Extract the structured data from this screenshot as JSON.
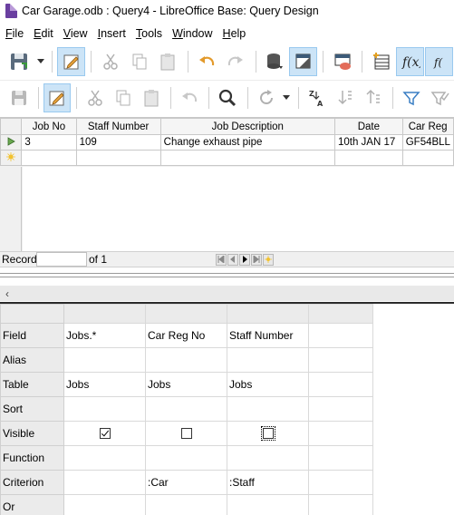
{
  "window": {
    "title": "Car Garage.odb : Query4 - LibreOffice Base: Query Design"
  },
  "menubar": [
    {
      "label": "File",
      "key": "F",
      "rest": "ile"
    },
    {
      "label": "Edit",
      "key": "E",
      "rest": "dit"
    },
    {
      "label": "View",
      "key": "V",
      "rest": "iew"
    },
    {
      "label": "Insert",
      "key": "I",
      "rest": "nsert"
    },
    {
      "label": "Tools",
      "key": "T",
      "rest": "ools"
    },
    {
      "label": "Window",
      "key": "W",
      "rest": "indow"
    },
    {
      "label": "Help",
      "key": "H",
      "rest": "elp"
    }
  ],
  "results": {
    "columns": [
      "Job No",
      "Staff Number",
      "Job Description",
      "Date",
      "Car Reg"
    ],
    "rows": [
      [
        "3",
        "109",
        "Change exhaust pipe",
        "10th JAN 17",
        "GF54BLL"
      ]
    ]
  },
  "recordbar": {
    "label": "Record",
    "value": "",
    "of_text": "of 1"
  },
  "design": {
    "row_labels": [
      "Field",
      "Alias",
      "Table",
      "Sort",
      "Visible",
      "Function",
      "Criterion",
      "Or"
    ],
    "columns": [
      {
        "field": "Jobs.*",
        "alias": "",
        "table": "Jobs",
        "sort": "",
        "visible": true,
        "function": "",
        "criterion": "",
        "or": ""
      },
      {
        "field": "Car Reg No",
        "alias": "",
        "table": "Jobs",
        "sort": "",
        "visible": false,
        "function": "",
        "criterion": ":Car",
        "or": ""
      },
      {
        "field": "Staff Number",
        "alias": "",
        "table": "Jobs",
        "sort": "",
        "visible": false,
        "function": "",
        "criterion": ":Staff",
        "or": ""
      }
    ]
  },
  "colors": {
    "active_toolbar_bg": "#cce4f7",
    "accent_purple": "#6a3fa0"
  }
}
